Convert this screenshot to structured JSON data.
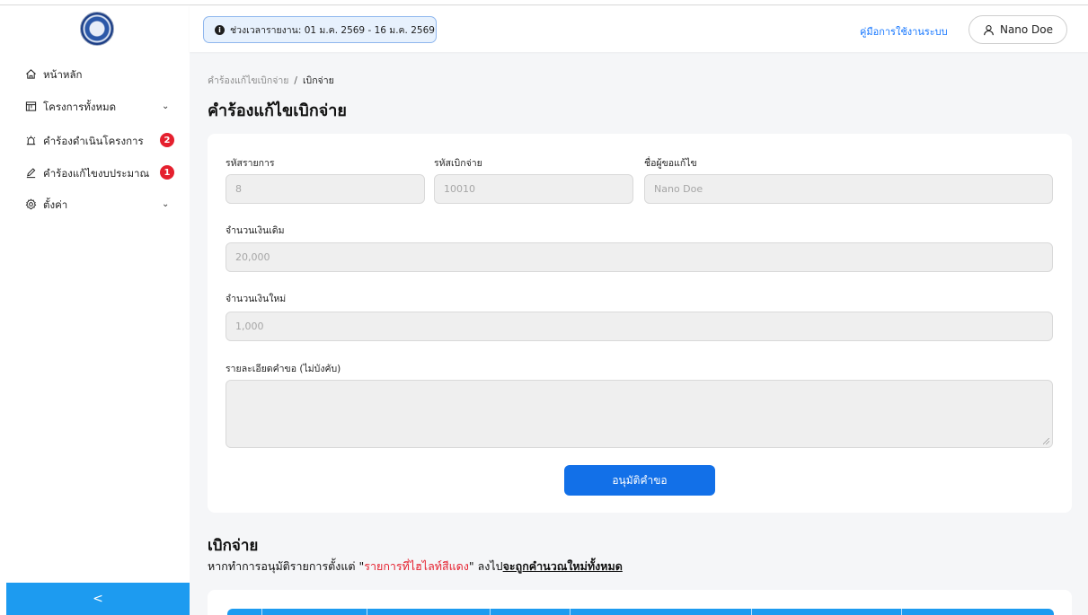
{
  "sidebar": {
    "items": [
      {
        "label": "หน้าหลัก",
        "icon": "home-icon"
      },
      {
        "label": "โครงการทั้งหมด",
        "icon": "projects-icon",
        "expandable": true
      },
      {
        "label": "คำร้องดำเนินโครงการ",
        "icon": "alarm-icon",
        "badge": "2"
      },
      {
        "label": "คำร้องแก้ไขงบประมาณ",
        "icon": "edit-icon",
        "badge": "1"
      },
      {
        "label": "ตั้งค่า",
        "icon": "gear-icon",
        "expandable": true
      }
    ],
    "collapse_label": "<",
    "chevron": "⌄"
  },
  "header": {
    "period_text": "ช่วงเวลารายงาน: 01 ม.ค. 2569 - 16 ม.ค. 2569",
    "info_glyph": "i",
    "manual_link": "คู่มือการใช้งานระบบ",
    "user_name": "Nano Doe"
  },
  "breadcrumb": {
    "parent": "คำร้องแก้ไขเบิกจ่าย",
    "separator": "/",
    "current": "เบิกจ่าย"
  },
  "page_title": "คำร้องแก้ไขเบิกจ่าย",
  "form": {
    "item_code_label": "รหัสรายการ",
    "item_code_value": "8",
    "disbursement_code_label": "รหัสเบิกจ่าย",
    "disbursement_code_value": "10010",
    "requester_label": "ชื่อผู้ขอแก้ไข",
    "requester_value": "Nano Doe",
    "original_amount_label": "จำนวนเงินเดิม",
    "original_amount_value": "20,000",
    "new_amount_label": "จำนวนเงินใหม่",
    "new_amount_value": "1,000",
    "details_label": "รายละเอียดคำขอ (ไม่บังคับ)",
    "details_value": "",
    "approve_button": "อนุมัติคำขอ"
  },
  "disbursement_section": {
    "title": "เบิกจ่าย",
    "note_prefix": "หากทำการอนุมัติรายการตั้งแต่ \"",
    "note_highlight": "รายการที่ไฮไลท์สีแดง",
    "note_middle": "\" ลงไป",
    "note_emphasis": "จะถูกคำนวณใหม่ทั้งหมด"
  },
  "colors": {
    "primary": "#1270e8",
    "sidebar_accent": "#1d9bf0",
    "badge_red": "#e5202e",
    "highlight_red": "#e5202e"
  }
}
